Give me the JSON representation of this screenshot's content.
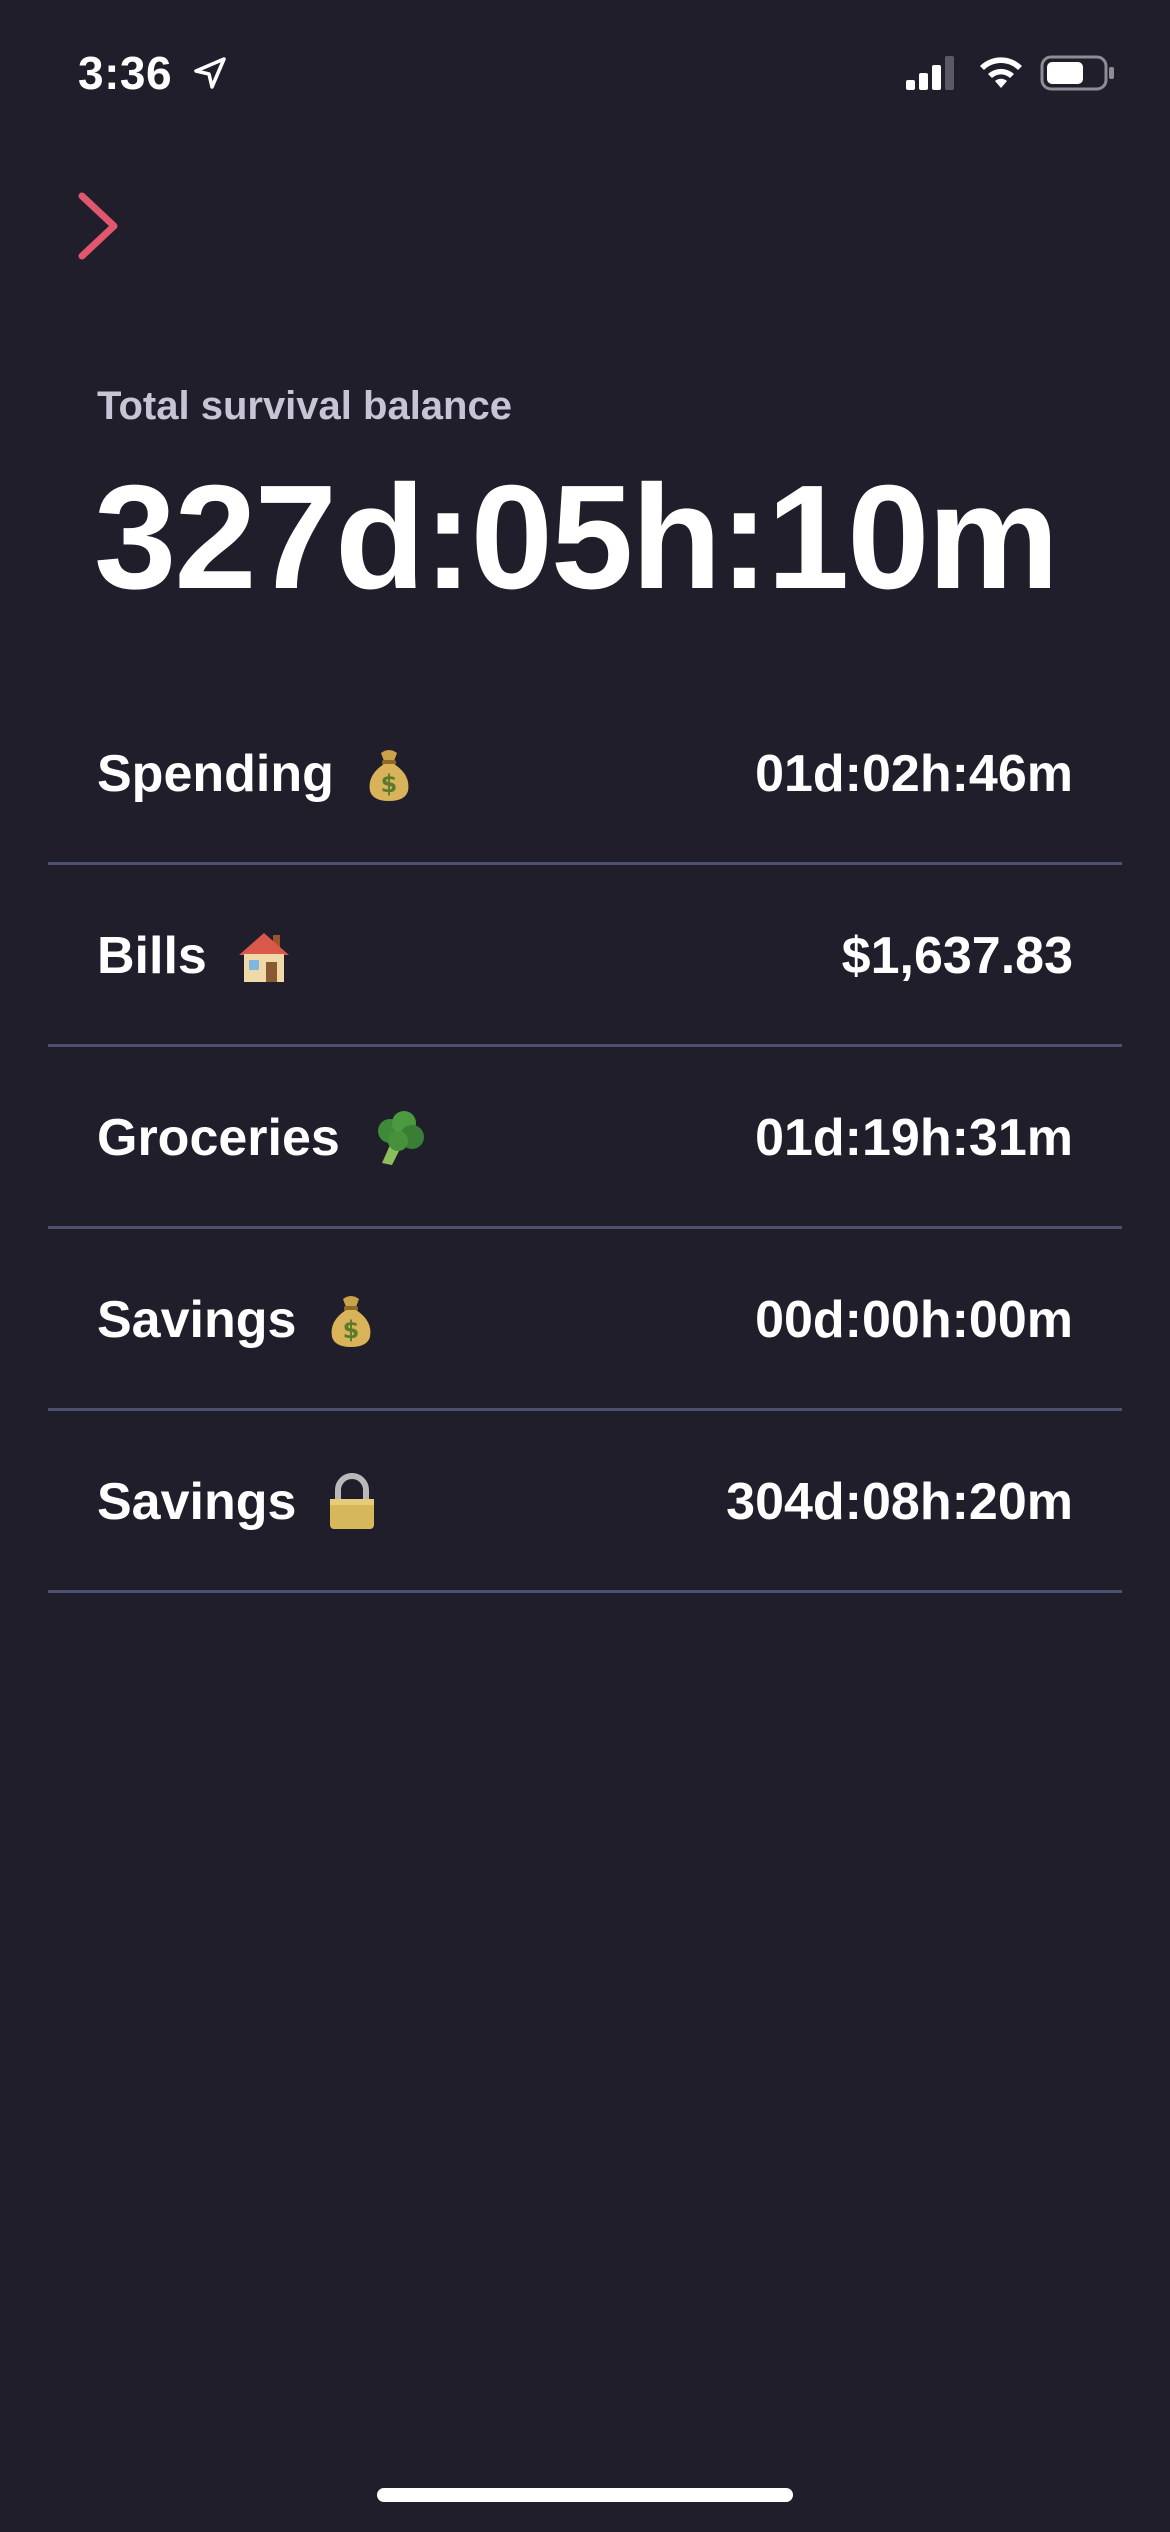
{
  "status_bar": {
    "time": "3:36",
    "location_icon": "location-arrow-icon",
    "signal_icon": "cellular-signal-icon",
    "wifi_icon": "wifi-icon",
    "battery_icon": "battery-icon"
  },
  "nav": {
    "chevron_icon": "chevron-right-icon",
    "accent_color": "#e0576f"
  },
  "balance": {
    "label": "Total survival balance",
    "value": "327d:05h:10m"
  },
  "categories": [
    {
      "label": "Spending",
      "emoji": "money-bag-icon",
      "value": "01d:02h:46m"
    },
    {
      "label": "Bills",
      "emoji": "house-icon",
      "value": "$1,637.83"
    },
    {
      "label": "Groceries",
      "emoji": "broccoli-icon",
      "value": "01d:19h:31m"
    },
    {
      "label": "Savings",
      "emoji": "money-bag-icon",
      "value": "00d:00h:00m"
    },
    {
      "label": "Savings",
      "emoji": "lock-icon",
      "value": "304d:08h:20m"
    }
  ],
  "colors": {
    "background": "#1f1e2a",
    "divider": "#4e5072",
    "label_muted": "#c6c5d6",
    "text": "#ffffff"
  }
}
